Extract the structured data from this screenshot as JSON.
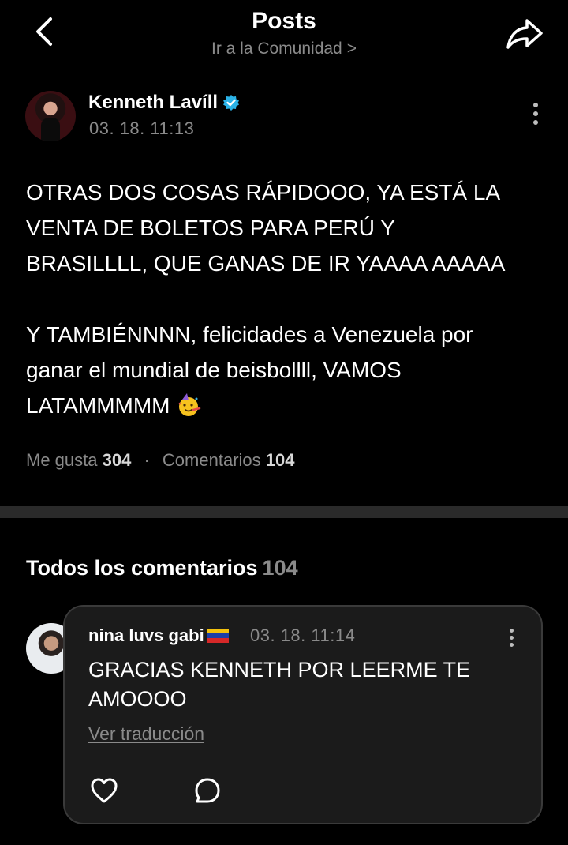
{
  "header": {
    "title": "Posts",
    "subtitle": "Ir a la Comunidad",
    "subtitle_chevron": ">"
  },
  "post": {
    "author": "Kenneth Lavíll",
    "verified": true,
    "time": "03. 18. 11:13",
    "paragraph1": "OTRAS DOS COSAS RÁPIDOOO, YA ESTÁ LA\nVENTA DE BOLETOS PARA PERÚ Y\nBRASILLLL, QUE GANAS DE IR YAAAA AAAAA",
    "paragraph2": "Y TAMBIÉNNNN, felicidades a Venezuela por\nganar el mundial de beisbollll, VAMOS\nLATAMMMMM",
    "emoji": "party-face-emoji",
    "likes_label": "Me gusta",
    "likes": "304",
    "separator": "·",
    "comments_label": "Comentarios",
    "comments": "104"
  },
  "comments_section": {
    "title": "Todos los comentarios",
    "count": "104"
  },
  "comment": {
    "author": "nina luvs gabi",
    "flag": "venezuela-flag",
    "time": "03. 18. 11:14",
    "text": "GRACIAS KENNETH POR LEERME TE AMOOOO",
    "translate_label": "Ver traducción"
  },
  "colors": {
    "background": "#000000",
    "muted_text": "#8a8a8a",
    "verified_badge": "#2bb3e8",
    "divider": "#2a2a2a",
    "card_bg": "#1b1b1b"
  }
}
